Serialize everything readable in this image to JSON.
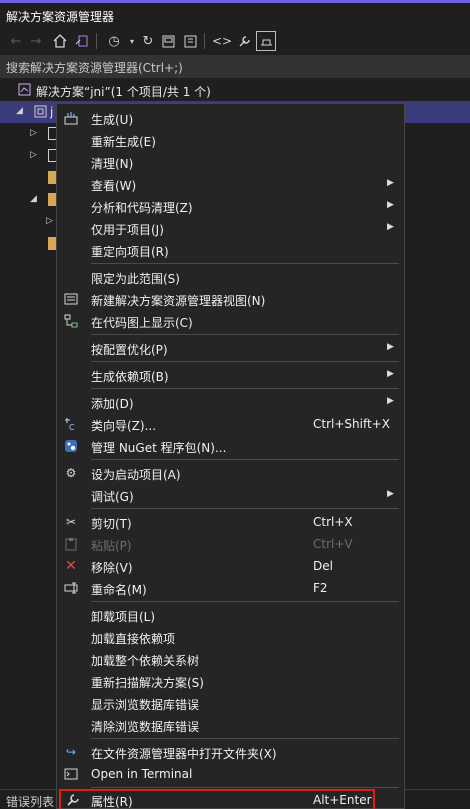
{
  "window": {
    "title": "解决方案资源管理器"
  },
  "search": {
    "placeholder": "搜索解决方案资源管理器(Ctrl+;)"
  },
  "tree": {
    "solution_label": "解决方案“jni”(1 个项目/共 1 个)",
    "project_label": "j"
  },
  "bottom": {
    "tab_label": "错误列表"
  },
  "colors": {
    "accent": "#7160e8",
    "selection": "#3b3a7a",
    "highlight_border": "#e21b1b",
    "menu_bg": "#252526"
  },
  "menu": {
    "items": [
      {
        "label": "生成(U)",
        "icon": "build-icon"
      },
      {
        "label": "重新生成(E)"
      },
      {
        "label": "清理(N)"
      },
      {
        "label": "查看(W)",
        "submenu": true
      },
      {
        "label": "分析和代码清理(Z)",
        "submenu": true
      },
      {
        "label": "仅用于项目(J)",
        "submenu": true
      },
      {
        "label": "重定向项目(R)"
      },
      {
        "label": "限定为此范围(S)"
      },
      {
        "label": "新建解决方案资源管理器视图(N)",
        "icon": "new-view-icon"
      },
      {
        "label": "在代码图上显示(C)",
        "icon": "code-map-icon"
      },
      {
        "label": "按配置优化(P)",
        "submenu": true
      },
      {
        "label": "生成依赖项(B)",
        "submenu": true
      },
      {
        "label": "添加(D)",
        "submenu": true
      },
      {
        "label": "类向导(Z)...",
        "shortcut": "Ctrl+Shift+X",
        "icon": "class-wizard-icon"
      },
      {
        "label": "管理 NuGet 程序包(N)...",
        "icon": "nuget-icon"
      },
      {
        "label": "设为启动项目(A)",
        "icon": "gear-icon"
      },
      {
        "label": "调试(G)",
        "submenu": true
      },
      {
        "label": "剪切(T)",
        "shortcut": "Ctrl+X",
        "icon": "scissors-icon"
      },
      {
        "label": "粘贴(P)",
        "shortcut": "Ctrl+V",
        "icon": "paste-icon",
        "disabled": true
      },
      {
        "label": "移除(V)",
        "shortcut": "Del",
        "icon": "remove-icon"
      },
      {
        "label": "重命名(M)",
        "shortcut": "F2",
        "icon": "rename-icon"
      },
      {
        "label": "卸载项目(L)"
      },
      {
        "label": "加载直接依赖项"
      },
      {
        "label": "加载整个依赖关系树"
      },
      {
        "label": "重新扫描解决方案(S)"
      },
      {
        "label": "显示浏览数据库错误"
      },
      {
        "label": "清除浏览数据库错误"
      },
      {
        "label": "在文件资源管理器中打开文件夹(X)",
        "icon": "open-folder-icon"
      },
      {
        "label": "Open in Terminal",
        "icon": "terminal-icon"
      },
      {
        "label": "属性(R)",
        "shortcut": "Alt+Enter",
        "icon": "wrench-icon"
      }
    ]
  }
}
